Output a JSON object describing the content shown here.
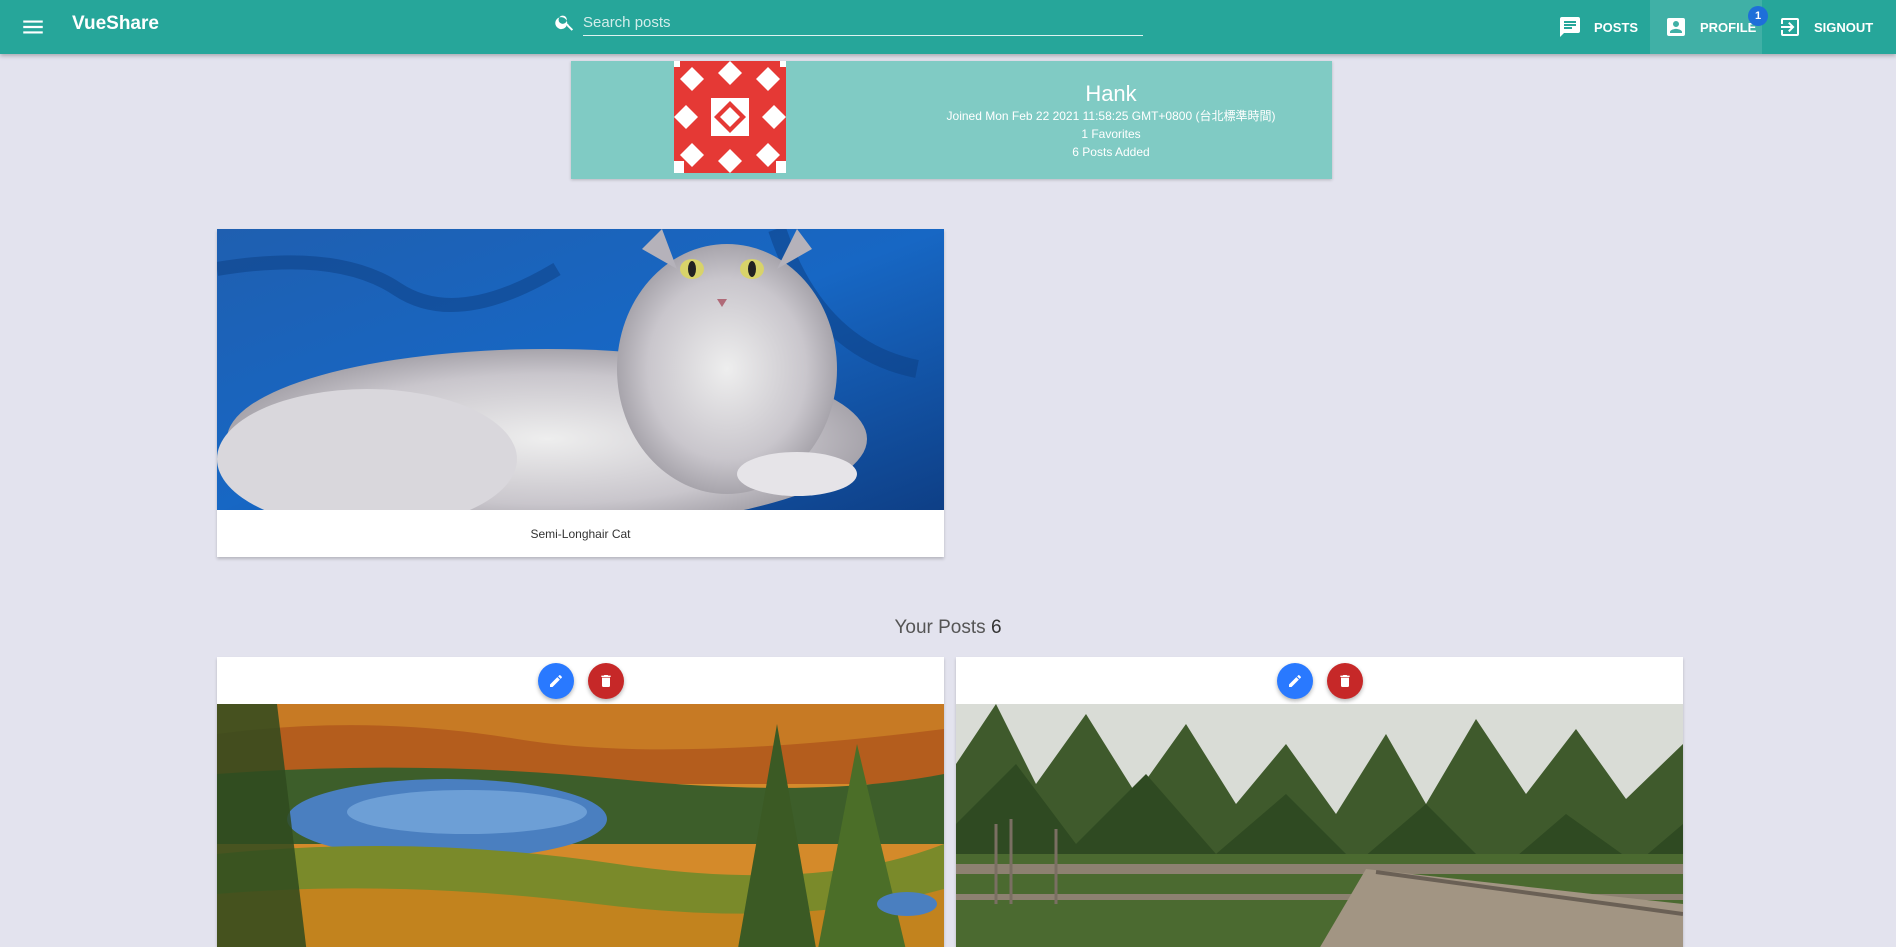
{
  "app": {
    "title": "VueShare"
  },
  "search": {
    "placeholder": "Search posts"
  },
  "nav": {
    "posts_label": "POSTS",
    "profile_label": "PROFILE",
    "profile_badge": "1",
    "signout_label": "SIGNOUT"
  },
  "profile": {
    "name": "Hank",
    "joined": "Joined Mon Feb 22 2021 11:58:25 GMT+0800 (台北標準時間)",
    "favorites": "1 Favorites",
    "posts_added": "6 Posts Added"
  },
  "favorites": [
    {
      "caption": "Semi-Longhair Cat"
    }
  ],
  "your_posts": {
    "title": "Your Posts",
    "count": "6"
  },
  "colors": {
    "toolbar": "#26a69a",
    "profile_card": "#80cbc4",
    "edit_button": "#2979ff",
    "delete_button": "#c62828",
    "badge": "#1e6fd9"
  },
  "icons": {
    "menu": "menu-icon",
    "search": "search-icon",
    "posts": "chat-icon",
    "profile": "account-box-icon",
    "signout": "exit-icon",
    "edit": "pencil-icon",
    "delete": "trash-icon"
  }
}
